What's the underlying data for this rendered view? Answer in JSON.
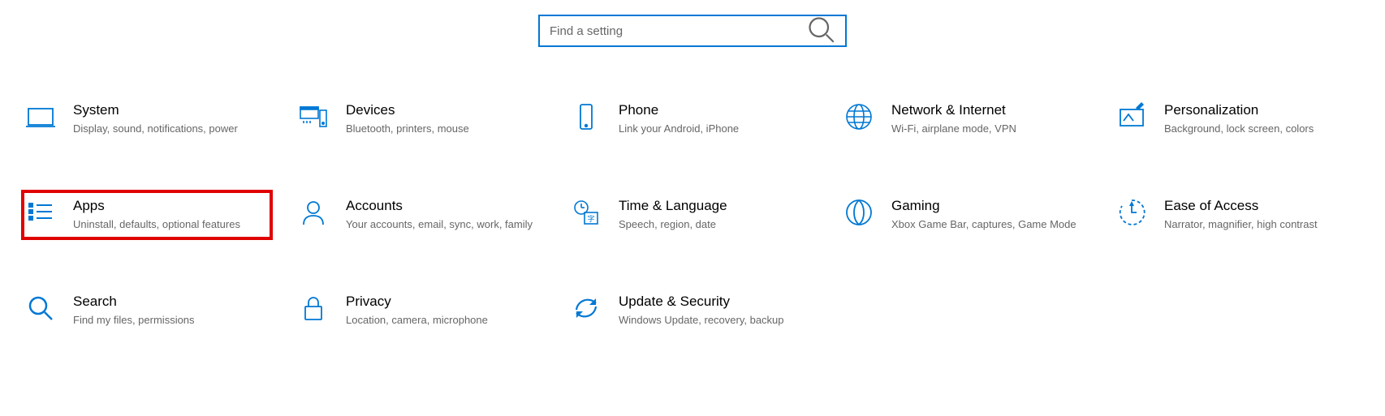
{
  "search": {
    "placeholder": "Find a setting"
  },
  "tiles": [
    {
      "id": "system",
      "title": "System",
      "desc": "Display, sound, notifications, power",
      "highlighted": false
    },
    {
      "id": "devices",
      "title": "Devices",
      "desc": "Bluetooth, printers, mouse",
      "highlighted": false
    },
    {
      "id": "phone",
      "title": "Phone",
      "desc": "Link your Android, iPhone",
      "highlighted": false
    },
    {
      "id": "network",
      "title": "Network & Internet",
      "desc": "Wi-Fi, airplane mode, VPN",
      "highlighted": false
    },
    {
      "id": "personalization",
      "title": "Personalization",
      "desc": "Background, lock screen, colors",
      "highlighted": false
    },
    {
      "id": "apps",
      "title": "Apps",
      "desc": "Uninstall, defaults, optional features",
      "highlighted": true
    },
    {
      "id": "accounts",
      "title": "Accounts",
      "desc": "Your accounts, email, sync, work, family",
      "highlighted": false
    },
    {
      "id": "time",
      "title": "Time & Language",
      "desc": "Speech, region, date",
      "highlighted": false
    },
    {
      "id": "gaming",
      "title": "Gaming",
      "desc": "Xbox Game Bar, captures, Game Mode",
      "highlighted": false
    },
    {
      "id": "ease",
      "title": "Ease of Access",
      "desc": "Narrator, magnifier, high contrast",
      "highlighted": false
    },
    {
      "id": "search",
      "title": "Search",
      "desc": "Find my files, permissions",
      "highlighted": false
    },
    {
      "id": "privacy",
      "title": "Privacy",
      "desc": "Location, camera, microphone",
      "highlighted": false
    },
    {
      "id": "update",
      "title": "Update & Security",
      "desc": "Windows Update, recovery, backup",
      "highlighted": false
    }
  ]
}
